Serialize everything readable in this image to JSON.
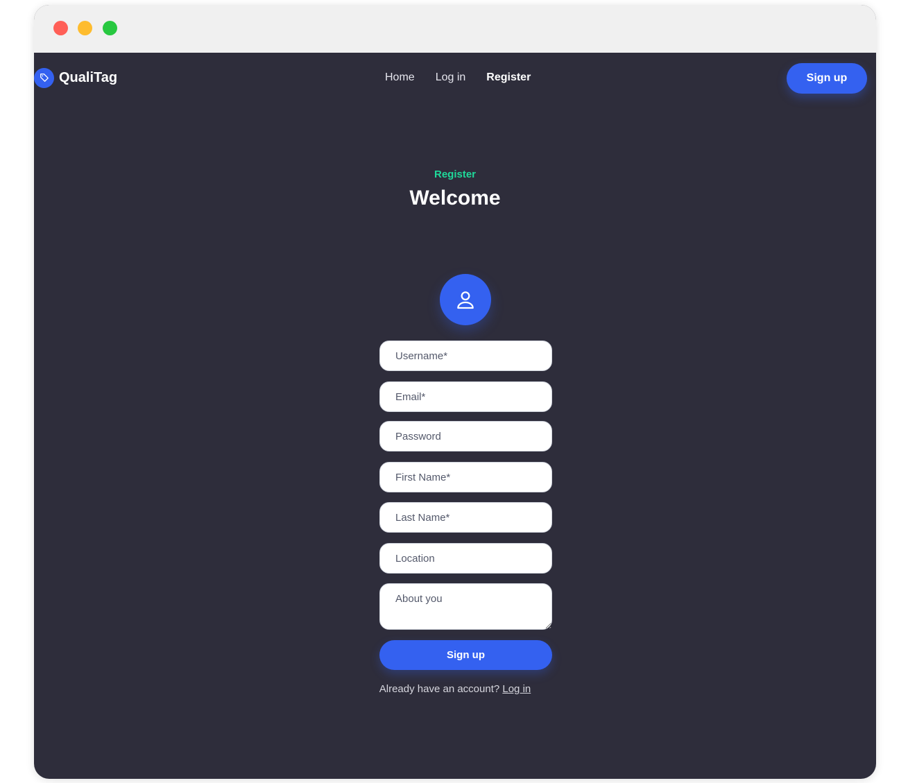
{
  "app": {
    "brand_name": "QualiTag",
    "brand_icon": "tag-icon",
    "accent_color": "#3461f0",
    "eyebrow_color": "#1fd99a"
  },
  "nav": {
    "links": [
      {
        "label": "Home"
      },
      {
        "label": "Log in"
      },
      {
        "label": "Register",
        "active": true
      }
    ],
    "signup_label": "Sign up"
  },
  "hero": {
    "eyebrow": "Register",
    "title": "Welcome"
  },
  "form": {
    "avatar_icon": "user-icon",
    "fields": {
      "username": {
        "placeholder": "Username*",
        "value": ""
      },
      "email": {
        "placeholder": "Email*",
        "value": ""
      },
      "password": {
        "placeholder": "Password",
        "value": ""
      },
      "first_name": {
        "placeholder": "First Name*",
        "value": ""
      },
      "last_name": {
        "placeholder": "Last Name*",
        "value": ""
      },
      "location": {
        "placeholder": "Location",
        "value": ""
      },
      "about": {
        "placeholder": "About you",
        "value": ""
      }
    },
    "submit_label": "Sign up",
    "footer_text": "Already have an account?",
    "footer_link": "Log in"
  }
}
